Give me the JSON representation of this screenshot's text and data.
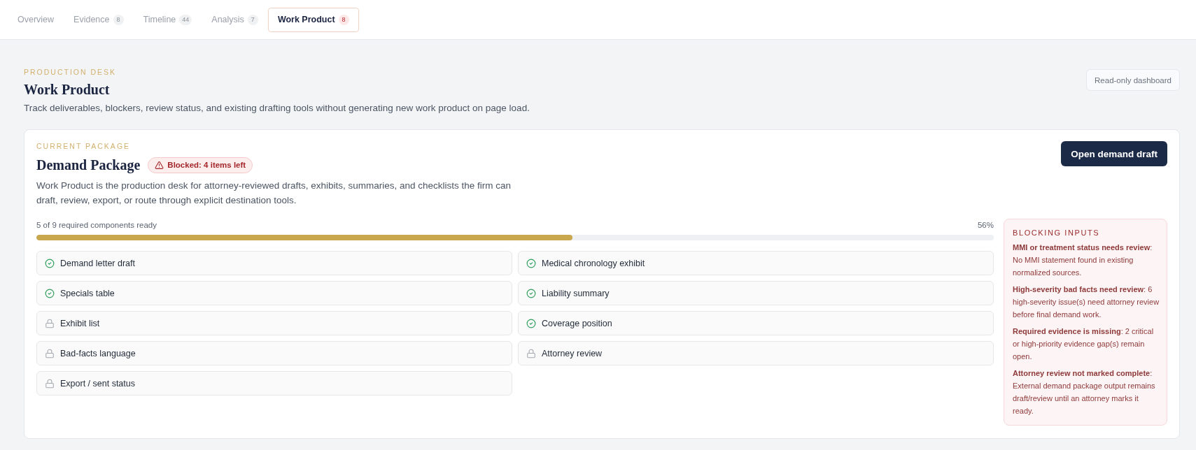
{
  "tabs": [
    {
      "label": "Overview",
      "selected": false
    },
    {
      "label": "Evidence",
      "count": "8",
      "selected": false
    },
    {
      "label": "Timeline",
      "count": "44",
      "selected": false
    },
    {
      "label": "Analysis",
      "count": "7",
      "selected": false
    },
    {
      "label": "Work Product",
      "count": "8",
      "selected": true
    }
  ],
  "header": {
    "eyebrow": "PRODUCTION DESK",
    "title": "Work Product",
    "subtitle": "Track deliverables, blockers, review status, and existing drafting tools without generating new work product on page load.",
    "mode_label": "Read-only dashboard"
  },
  "package": {
    "eyebrow": "CURRENT PACKAGE",
    "title": "Demand Package",
    "status": {
      "label": "Blocked: 4 items left"
    },
    "description": "Work Product is the production desk for attorney-reviewed drafts, exhibits, summaries, and checklists the firm can draft, review, export, or route through explicit destination tools.",
    "action": "Open demand draft",
    "progress": {
      "label": "5 of 9 required components ready",
      "reading": "56%",
      "level": 0.56
    },
    "components": [
      {
        "label": "Demand letter draft",
        "ready": true
      },
      {
        "label": "Medical chronology exhibit",
        "ready": true
      },
      {
        "label": "Specials table",
        "ready": true
      },
      {
        "label": "Liability summary",
        "ready": true
      },
      {
        "label": "Exhibit list",
        "ready": false
      },
      {
        "label": "Coverage position",
        "ready": true
      },
      {
        "label": "Bad-facts language",
        "ready": false
      },
      {
        "label": "Attorney review",
        "ready": false
      },
      {
        "label": "Export / sent status",
        "ready": false
      }
    ],
    "blocking": {
      "title": "BLOCKING INPUTS",
      "items": [
        "**MMI or treatment status needs review**: No MMI statement found in existing normalized sources.",
        "**High-severity bad facts need review**: 6 high-severity issue(s) need attorney review before final demand work.",
        "**Required evidence is missing**: 2 critical or high-priority evidence gap(s) remain open.",
        "**Attorney review not marked complete**: External demand package output remains draft/review until an attorney marks it ready."
      ]
    }
  }
}
